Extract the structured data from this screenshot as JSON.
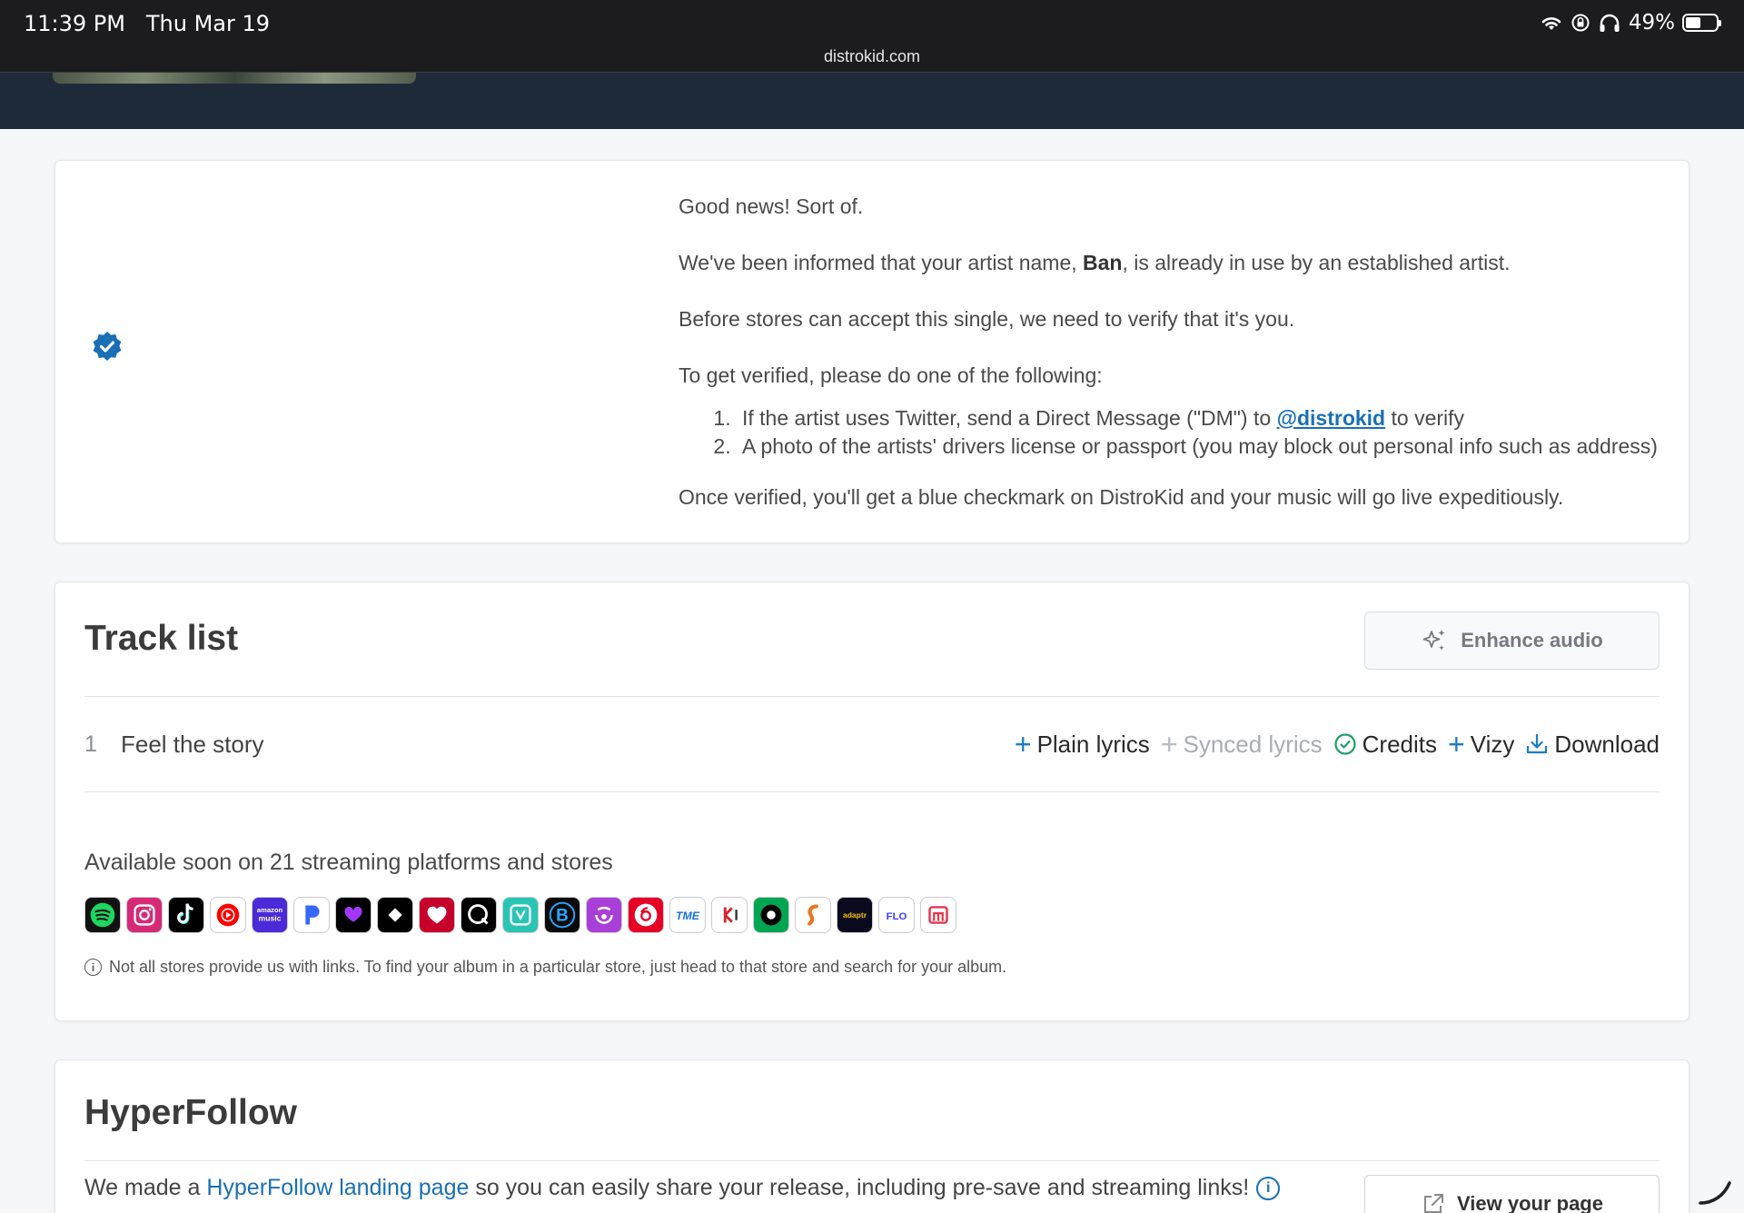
{
  "status_bar": {
    "time": "11:39 PM",
    "date": "Thu Mar 19",
    "battery": "49%",
    "url": "distrokid.com",
    "icons": [
      "wifi-icon",
      "rotation-lock-icon",
      "headphones-icon",
      "battery-icon"
    ]
  },
  "notice": {
    "badge_icon": "verified-badge-icon",
    "heading": "Good news! Sort of.",
    "line1_before": "We've been informed that your artist name, ",
    "artist_name": "Ban",
    "line1_after": ", is already in use by an established artist.",
    "line2": "Before stores can accept this single, we need to verify that it's you.",
    "line3": "To get verified, please do one of the following:",
    "option1_before": "If the artist uses Twitter, send a Direct Message (\"DM\") to ",
    "option1_handle": "@distrokid",
    "option1_after": " to verify",
    "option2": "A photo of the artists' drivers license or passport (you may block out personal info such as address)",
    "footer": "Once verified, you'll get a blue checkmark on DistroKid and your music will go live expeditiously."
  },
  "tracklist": {
    "title": "Track list",
    "enhance_label": "Enhance audio",
    "tracks": [
      {
        "number": "1",
        "name": "Feel the story"
      }
    ],
    "actions": {
      "plain_lyrics": "Plain lyrics",
      "synced_lyrics": "Synced lyrics",
      "credits": "Credits",
      "vizy": "Vizy",
      "download": "Download"
    },
    "available_text": "Available soon on 21 streaming platforms and stores",
    "stores": [
      {
        "name": "spotify",
        "bg": "#121212",
        "fg": "#1ed760"
      },
      {
        "name": "instagram",
        "bg": "#d62976",
        "fg": "#ffffff"
      },
      {
        "name": "tiktok",
        "bg": "#000000",
        "fg": "#ffffff"
      },
      {
        "name": "youtube-music",
        "bg": "#ffffff",
        "fg": "#ff0000"
      },
      {
        "name": "amazon-music",
        "bg": "#4b2ad8",
        "fg": "#ffffff"
      },
      {
        "name": "pandora",
        "bg": "#ffffff",
        "fg": "#3668ff"
      },
      {
        "name": "deezer",
        "bg": "#000000",
        "fg": "#a238ff"
      },
      {
        "name": "tidal",
        "bg": "#000000",
        "fg": "#ffffff"
      },
      {
        "name": "iheartradio",
        "bg": "#c6002b",
        "fg": "#ffffff"
      },
      {
        "name": "qobuz",
        "bg": "#000000",
        "fg": "#ffffff"
      },
      {
        "name": "jiosaavn",
        "bg": "#2bc5b4",
        "fg": "#ffffff"
      },
      {
        "name": "boomplay",
        "bg": "#0b0b0b",
        "fg": "#2aa6ff"
      },
      {
        "name": "anghami",
        "bg": "#a93fd9",
        "fg": "#ffffff"
      },
      {
        "name": "netease",
        "bg": "#e60026",
        "fg": "#ffffff"
      },
      {
        "name": "tme",
        "bg": "#ffffff",
        "fg": "#1a6fd8"
      },
      {
        "name": "kkbox",
        "bg": "#ffffff",
        "fg": "#d7242c"
      },
      {
        "name": "audiomack",
        "bg": "#00a651",
        "fg": "#000000"
      },
      {
        "name": "gaana",
        "bg": "#ffffff",
        "fg": "#e87722"
      },
      {
        "name": "adaptr",
        "bg": "#0a0a1f",
        "fg": "#f5c400"
      },
      {
        "name": "flo",
        "bg": "#ffffff",
        "fg": "#3d3dff"
      },
      {
        "name": "melon",
        "bg": "#ffffff",
        "fg": "#e2384d"
      }
    ],
    "footnote": "Not all stores provide us with links. To find your album in a particular store, just head to that store and search for your album."
  },
  "hyperfollow": {
    "title": "HyperFollow",
    "text_before": "We made a ",
    "link_text": "HyperFollow landing page",
    "text_after": " so you can easily share your release, including pre-save and streaming links!",
    "view_label": "View your page"
  }
}
